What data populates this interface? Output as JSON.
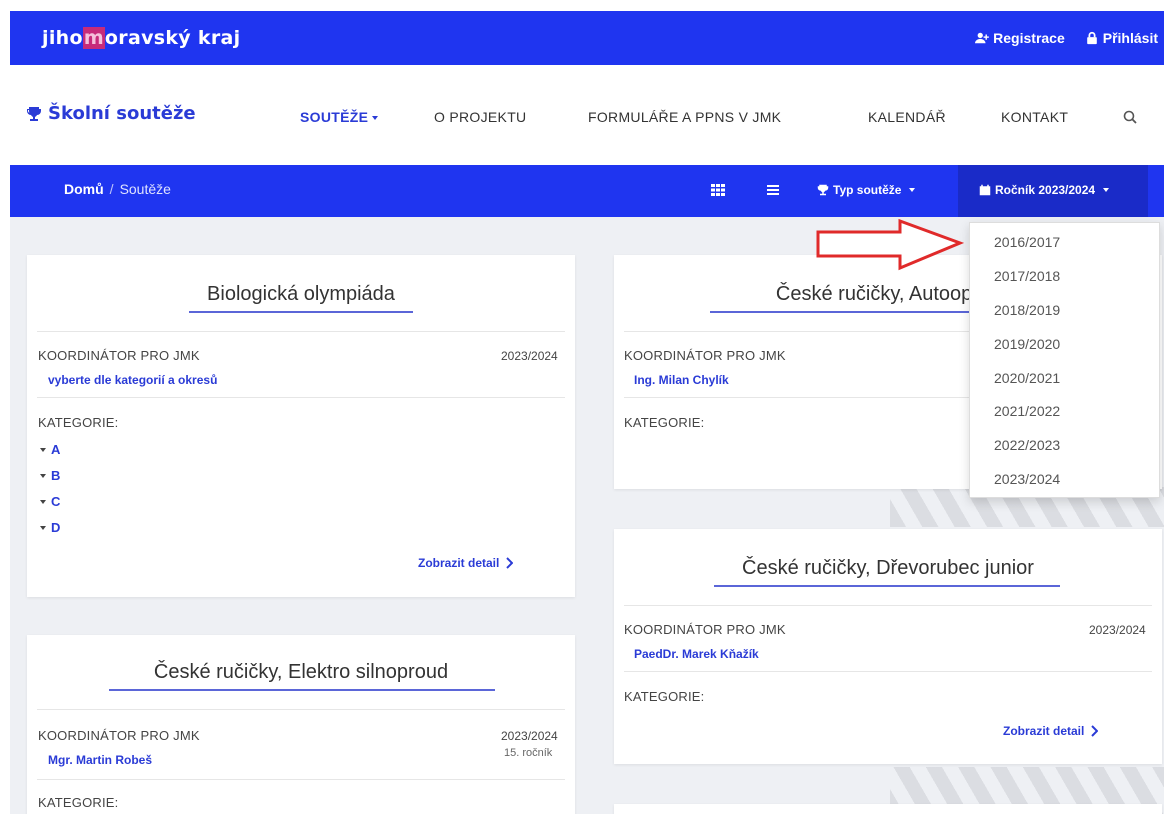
{
  "site": {
    "logo_pre": "jiho",
    "logo_m": "m",
    "logo_post": "oravský kraj"
  },
  "top_links": {
    "register": "Registrace",
    "login": "Přihlásit"
  },
  "nav": {
    "brand": "Školní soutěže",
    "items": [
      "SOUTĚŽE",
      "O PROJEKTU",
      "FORMULÁŘE A PPNS V JMK",
      "KALENDÁŘ",
      "KONTAKT"
    ]
  },
  "breadcrumb": {
    "home": "Domů",
    "sep": "/",
    "current": "Soutěže"
  },
  "filters": {
    "type": "Typ soutěže",
    "year": "Ročník 2023/2024"
  },
  "dropdown": {
    "options": [
      "2016/2017",
      "2017/2018",
      "2018/2019",
      "2019/2020",
      "2020/2021",
      "2021/2022",
      "2022/2023",
      "2023/2024"
    ]
  },
  "cards": {
    "bio": {
      "title": "Biologická olympiáda",
      "coord_label": "KOORDINÁTOR PRO JMK",
      "year": "2023/2024",
      "coord": "vyberte dle kategorií a okresů",
      "cat_label": "KATEGORIE:",
      "categories": [
        "A",
        "B",
        "C",
        "D"
      ],
      "detail": "Zobrazit detail"
    },
    "auto": {
      "title": "České ručičky, Autoopra",
      "coord_label": "KOORDINÁTOR PRO JMK",
      "coord": "Ing. Milan Chylík",
      "cat_label": "KATEGORIE:"
    },
    "drevo": {
      "title": "České ručičky, Dřevorubec junior",
      "coord_label": "KOORDINÁTOR PRO JMK",
      "year": "2023/2024",
      "coord": "PaedDr. Marek Kňažík",
      "cat_label": "KATEGORIE:",
      "detail": "Zobrazit detail"
    },
    "elektro": {
      "title": "České ručičky, Elektro silnoproud",
      "coord_label": "KOORDINÁTOR PRO JMK",
      "year": "2023/2024",
      "note": "15. ročník",
      "coord": "Mgr. Martin Robeš",
      "cat_label": "KATEGORIE:"
    }
  },
  "colors": {
    "primary_blue": "#1f35f0",
    "link_blue": "#2a3bd6",
    "arrow_red": "#e02a2a"
  }
}
